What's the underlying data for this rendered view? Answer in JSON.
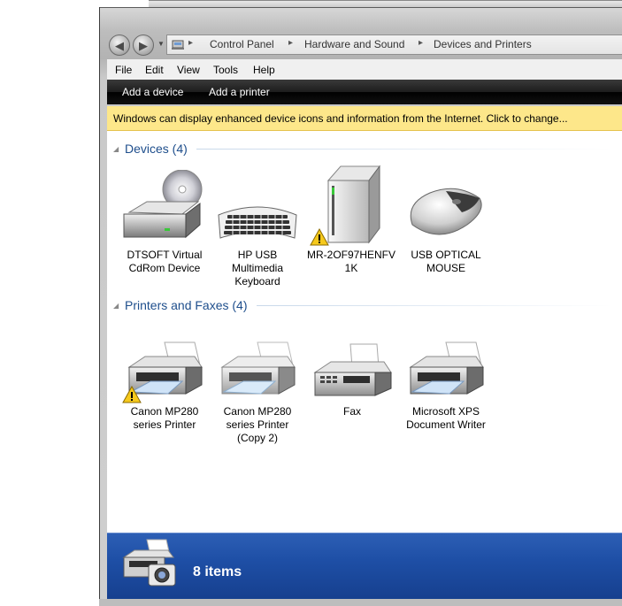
{
  "breadcrumb": [
    "Control Panel",
    "Hardware and Sound",
    "Devices and Printers"
  ],
  "menu": [
    "File",
    "Edit",
    "View",
    "Tools",
    "Help"
  ],
  "commands": [
    "Add a device",
    "Add a printer"
  ],
  "infobar": "Windows can display enhanced device icons and information from the Internet. Click to change...",
  "groups": {
    "devices": "Devices (4)",
    "printers": "Printers and Faxes (4)"
  },
  "devices": [
    {
      "l1": "DTSOFT Virtual",
      "l2": "CdRom Device",
      "l3": "",
      "icon": "cdrom-drive-icon"
    },
    {
      "l1": "HP USB",
      "l2": "Multimedia",
      "l3": "Keyboard",
      "icon": "keyboard-icon"
    },
    {
      "l1": "MR-2OF97HENFV",
      "l2": "1K",
      "l3": "",
      "icon": "computer-tower-icon",
      "warning": true
    },
    {
      "l1": "USB OPTICAL",
      "l2": "MOUSE",
      "l3": "",
      "icon": "mouse-icon"
    }
  ],
  "printers": [
    {
      "l1": "Canon MP280",
      "l2": "series Printer",
      "l3": "",
      "icon": "printer-icon",
      "warning": true
    },
    {
      "l1": "Canon MP280",
      "l2": "series Printer",
      "l3": "(Copy 2)",
      "icon": "printer-icon"
    },
    {
      "l1": "Fax",
      "l2": "",
      "l3": "",
      "icon": "fax-icon"
    },
    {
      "l1": "Microsoft XPS",
      "l2": "Document Writer",
      "l3": "",
      "icon": "printer-icon"
    }
  ],
  "status": {
    "text": "8 items",
    "icon": "printer-camera-icon"
  }
}
